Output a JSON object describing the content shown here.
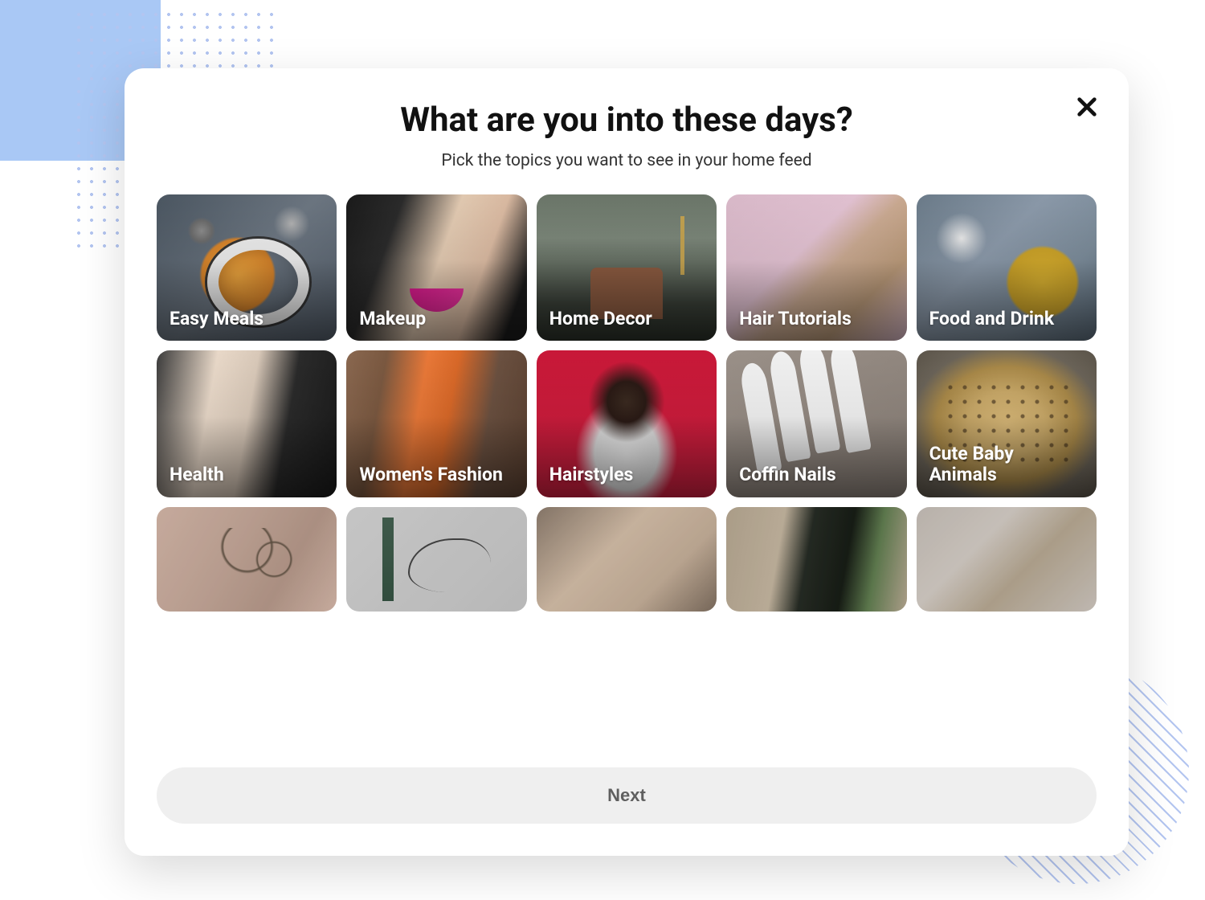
{
  "modal": {
    "title": "What are you into these days?",
    "subtitle": "Pick the topics you want to see in your home feed",
    "close_label": "Close",
    "next_label": "Next"
  },
  "topics": [
    {
      "id": "easy-meals",
      "label": "Easy Meals"
    },
    {
      "id": "makeup",
      "label": "Makeup"
    },
    {
      "id": "home-decor",
      "label": "Home Decor"
    },
    {
      "id": "hair-tutorials",
      "label": "Hair Tutorials"
    },
    {
      "id": "food-drink",
      "label": "Food and Drink"
    },
    {
      "id": "health",
      "label": "Health"
    },
    {
      "id": "womens-fashion",
      "label": "Women's Fashion"
    },
    {
      "id": "hairstyles",
      "label": "Hairstyles"
    },
    {
      "id": "coffin-nails",
      "label": "Coffin Nails"
    },
    {
      "id": "cute-animals",
      "label": "Cute Baby Animals"
    },
    {
      "id": "tattoo",
      "label": ""
    },
    {
      "id": "sketch",
      "label": ""
    },
    {
      "id": "hands",
      "label": ""
    },
    {
      "id": "quote",
      "label": ""
    },
    {
      "id": "bracelet",
      "label": ""
    }
  ]
}
